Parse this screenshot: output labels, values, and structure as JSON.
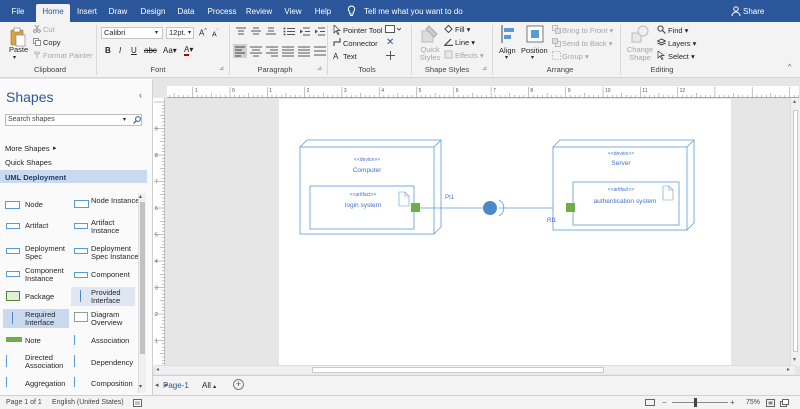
{
  "ribbon_tabs": [
    "File",
    "Home",
    "Insert",
    "Draw",
    "Design",
    "Data",
    "Process",
    "Review",
    "View",
    "Help"
  ],
  "tell_me": "Tell me what you want to do",
  "share": "Share",
  "clipboard": {
    "paste": "Paste",
    "cut": "Cut",
    "copy": "Copy",
    "format_painter": "Format Painter",
    "label": "Clipboard"
  },
  "font": {
    "name": "Calibri",
    "size": "12pt.",
    "label": "Font"
  },
  "paragraph": {
    "label": "Paragraph"
  },
  "tools": {
    "pointer": "Pointer Tool",
    "connector": "Connector",
    "text": "Text",
    "label": "Tools"
  },
  "shape_styles": {
    "quick_styles": "Quick Styles",
    "fill": "Fill",
    "line": "Line",
    "effects": "Effects",
    "label": "Shape Styles"
  },
  "arrange": {
    "align": "Align",
    "position": "Position",
    "bring_front": "Bring to Front",
    "send_back": "Send to Back",
    "group": "Group",
    "label": "Arrange"
  },
  "editing": {
    "change_shape": "Change Shape",
    "find": "Find",
    "layers": "Layers",
    "select": "Select",
    "label": "Editing"
  },
  "shapes_panel": {
    "title": "Shapes",
    "search_placeholder": "Search shapes",
    "more_shapes": "More Shapes",
    "quick_shapes": "Quick Shapes",
    "uml_deployment": "UML Deployment",
    "items": [
      {
        "label": "Node",
        "icon": "node-icon"
      },
      {
        "label": "Node Instance",
        "icon": "node-instance-icon"
      },
      {
        "label": "Artifact",
        "icon": "artifact-icon"
      },
      {
        "label": "Artifact Instance",
        "icon": "artifact-instance-icon"
      },
      {
        "label": "Deployment Spec",
        "icon": "deployment-spec-icon"
      },
      {
        "label": "Deployment Spec Instance",
        "icon": "deployment-spec-instance-icon"
      },
      {
        "label": "Component Instance",
        "icon": "component-instance-icon"
      },
      {
        "label": "Component",
        "icon": "component-icon"
      },
      {
        "label": "Package",
        "icon": "package-icon"
      },
      {
        "label": "Provided Interface",
        "icon": "provided-interface-icon"
      },
      {
        "label": "Required Interface",
        "icon": "required-interface-icon"
      },
      {
        "label": "Diagram Overview",
        "icon": "diagram-overview-icon"
      },
      {
        "label": "Note",
        "icon": "note-icon"
      },
      {
        "label": "Association",
        "icon": "association-icon"
      },
      {
        "label": "Directed Association",
        "icon": "directed-association-icon"
      },
      {
        "label": "Dependency",
        "icon": "dependency-icon"
      },
      {
        "label": "Aggregation",
        "icon": "aggregation-icon"
      },
      {
        "label": "Composition",
        "icon": "composition-icon"
      }
    ]
  },
  "diagram": {
    "node1_stereotype": "<<device>>",
    "node1_name": "Computer",
    "artifact1_stereotype": "<<artifact>>",
    "artifact1_name": "login system",
    "node2_stereotype": "<<device>>",
    "node2_name": "Server",
    "artifact2_stereotype": "<<artifact>>",
    "artifact2_name": "authentication system",
    "port1_label": "PI1",
    "port2_label": "RI1"
  },
  "ruler_h": [
    "2",
    "1",
    "0",
    "1",
    "2",
    "3",
    "4",
    "5",
    "6",
    "7",
    "8",
    "9",
    "10",
    "11",
    "12"
  ],
  "ruler_v": [
    "9",
    "8",
    "7",
    "6",
    "5",
    "4",
    "3",
    "2",
    "1"
  ],
  "page_tabs": {
    "active": "Page-1",
    "all": "All"
  },
  "status": {
    "page": "Page 1 of 1",
    "language": "English (United States)",
    "zoom": "75%"
  },
  "colors": {
    "accent": "#2b579a",
    "shape_line": "#5b9bd5",
    "port_green": "#70ad47",
    "interface_blue": "#4a8ac9"
  }
}
